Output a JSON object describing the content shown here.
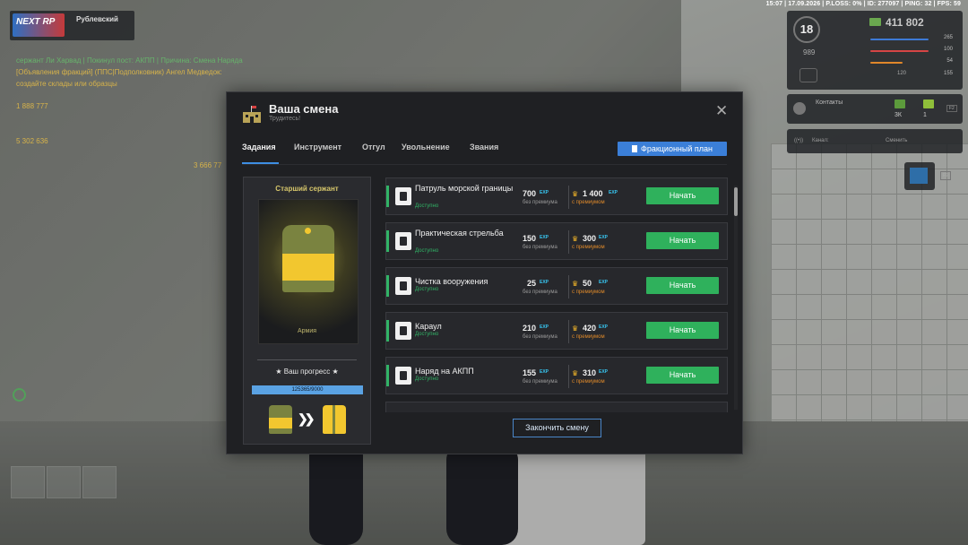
{
  "status_bar": "15:07 | 17.09.2026 | P.LOSS: 0% | ID: 277097 | PING: 32 | FPS: 59",
  "logo": {
    "text": "NEXT RP",
    "server": "Рублевский"
  },
  "chat": [
    {
      "text": "сержант Ли Харвад | Покинул пост: АКПП | Причина: Смена Наряда",
      "color": "green"
    },
    {
      "text": "[Объявления фракций] (ППС|Подполковник) Ангел Медведок:",
      "color": "yel"
    },
    {
      "text": "создайте склады или образцы",
      "color": "yel"
    },
    {
      "text": "1 888 777",
      "color": "yel"
    },
    {
      "text": "5 302 636",
      "color": "yel"
    },
    {
      "text": "3 666 77",
      "color": "yel"
    }
  ],
  "hud": {
    "level": "18",
    "money": "411 802",
    "stat_989": "989",
    "stats": [
      {
        "value": "265",
        "color": "#3d7ad6",
        "fill": 0.9
      },
      {
        "value": "100",
        "color": "#d64545",
        "fill": 0.9
      },
      {
        "value": "54",
        "color": "#e0872a",
        "fill": 0.5
      },
      {
        "value": "155",
        "color": "#8c8c8c",
        "fill": 0.4
      }
    ],
    "stat_120": "120",
    "contacts_title": "Контакты",
    "contacts_count1": "3К",
    "contacts_count2": "1",
    "contacts_key": "F2",
    "radio_channel": "Канал:",
    "radio_action": "Сменить",
    "small_key": "F9"
  },
  "modal": {
    "title": "Ваша смена",
    "subtitle": "Трудитесь!",
    "tabs": [
      "Задания",
      "Инструмент",
      "Отгул",
      "Увольнение",
      "Звания"
    ],
    "plan_button": "Фракционный план",
    "rank": {
      "name": "Старший сержант",
      "branch": "Армия",
      "progress_title": "★ Ваш прогресс ★",
      "progress_text": "125365/9000",
      "progress_fraction": 1.0
    },
    "tasks": [
      {
        "name": "Патруль морской границы",
        "status": "Доступно",
        "reward": "700",
        "reward_label": "без премиума",
        "premium": "1 400",
        "premium_label": "с премиумом",
        "button": "Начать"
      },
      {
        "name": "Практическая стрельба",
        "status": "Доступно",
        "reward": "150",
        "reward_label": "без премиума",
        "premium": "300",
        "premium_label": "с премиумом",
        "button": "Начать"
      },
      {
        "name": "Чистка вооружения",
        "status": "Доступно",
        "reward": "25",
        "reward_label": "без премиума",
        "premium": "50",
        "premium_label": "с премиумом",
        "button": "Начать"
      },
      {
        "name": "Караул",
        "status": "Доступно",
        "reward": "210",
        "reward_label": "без премиума",
        "premium": "420",
        "premium_label": "с премиумом",
        "button": "Начать"
      },
      {
        "name": "Наряд на АКПП",
        "status": "Доступно",
        "reward": "155",
        "reward_label": "без премиума",
        "premium": "310",
        "premium_label": "с премиумом",
        "button": "Начать"
      }
    ],
    "exp_label": "EXP",
    "end_button": "Закончить смену"
  }
}
